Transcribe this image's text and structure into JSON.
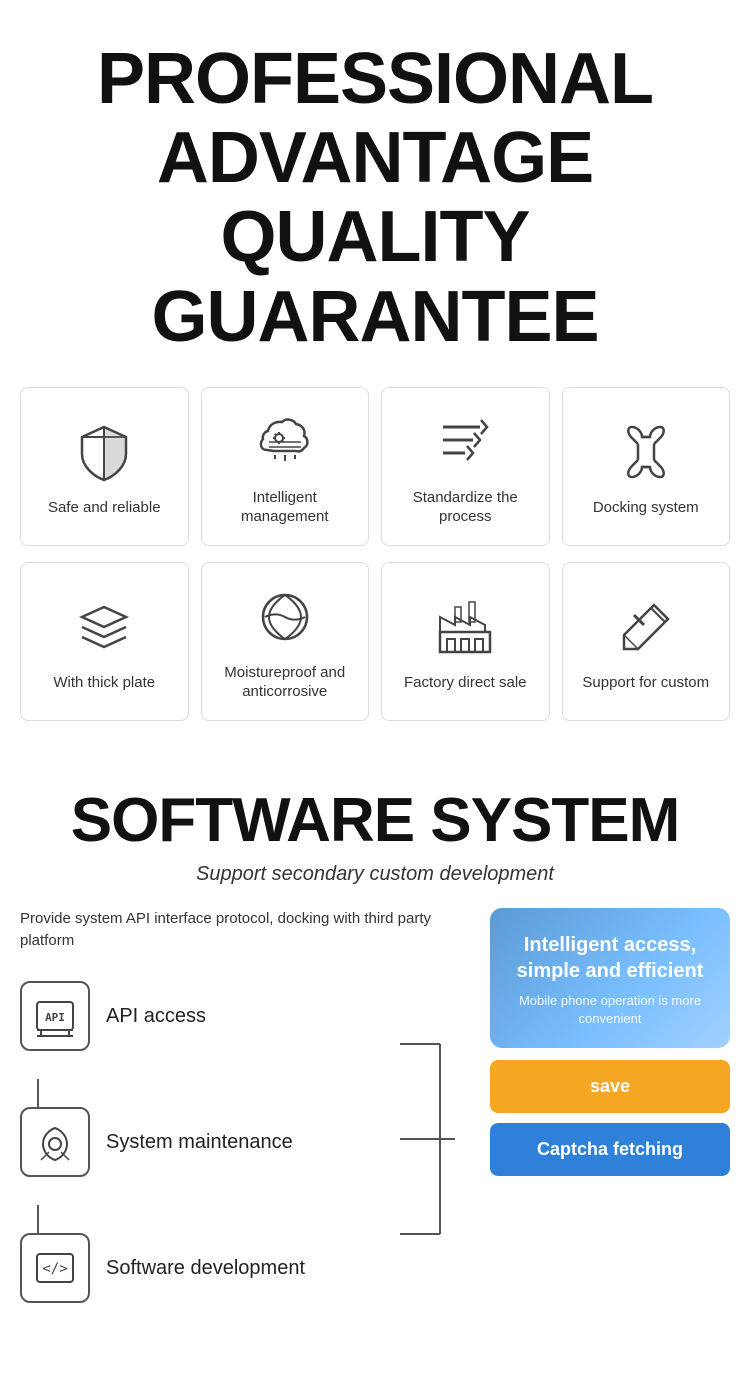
{
  "header": {
    "line1": "PROFESSIONAL",
    "line2": "ADVANTAGE",
    "line3": "QUALITY GUARANTEE"
  },
  "features_row1": [
    {
      "id": "safe-reliable",
      "label": "Safe and\nreliable",
      "icon": "shield"
    },
    {
      "id": "intelligent-mgmt",
      "label": "Intelligent\nmanagement",
      "icon": "cloud-settings"
    },
    {
      "id": "standardize",
      "label": "Standardize\nthe process",
      "icon": "process"
    },
    {
      "id": "docking",
      "label": "Docking\nsystem",
      "icon": "link"
    }
  ],
  "features_row2": [
    {
      "id": "thick-plate",
      "label": "With thick\nplate",
      "icon": "layers"
    },
    {
      "id": "moistureproof",
      "label": "Moistureproof\nand anticorrosive",
      "icon": "leaf"
    },
    {
      "id": "factory",
      "label": "Factory\ndirect sale",
      "icon": "factory"
    },
    {
      "id": "custom",
      "label": "Support for\ncustom",
      "icon": "tools"
    }
  ],
  "software": {
    "title": "SOFTWARE SYSTEM",
    "subtitle": "Support secondary custom development",
    "desc": "Provide system API interface protocol, docking with third party platform",
    "items": [
      {
        "id": "api",
        "label": "API access",
        "icon": "api"
      },
      {
        "id": "maintenance",
        "label": "System\nmaintenance",
        "icon": "wrench"
      },
      {
        "id": "development",
        "label": "Software\ndevelopment",
        "icon": "code"
      }
    ],
    "phone_card": {
      "title": "Intelligent access,\nsimple and efficient",
      "subtitle": "Mobile phone operation is more convenient"
    },
    "btn_save": "save",
    "btn_captcha": "Captcha fetching"
  }
}
